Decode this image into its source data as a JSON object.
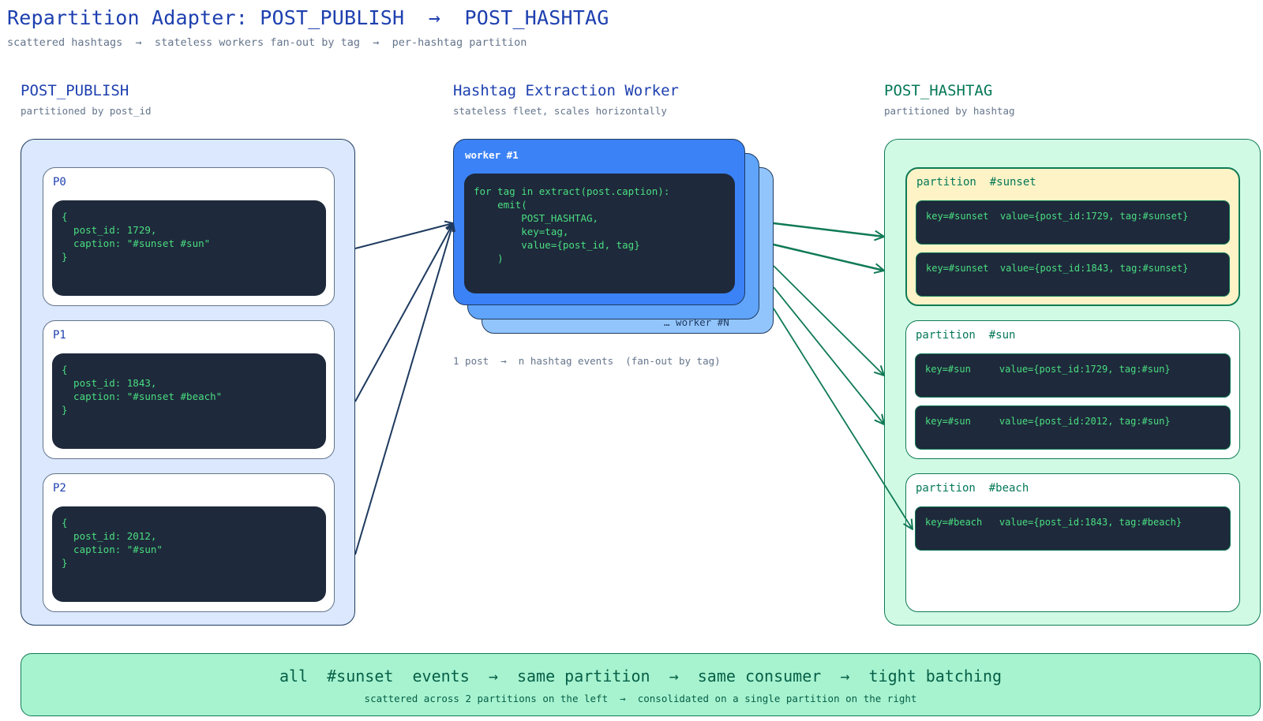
{
  "title": "Repartition Adapter: POST_PUBLISH  →  POST_HASHTAG",
  "subtitle": "scattered hashtags  →  stateless workers fan-out by tag  →  per-hashtag partition",
  "left": {
    "title": "POST_PUBLISH",
    "subtitle": "partitioned by post_id",
    "partitions": [
      {
        "label": "P0",
        "code": "{\n  post_id: 1729,\n  caption: \"#sunset #sun\"\n}"
      },
      {
        "label": "P1",
        "code": "{\n  post_id: 1843,\n  caption: \"#sunset #beach\"\n}"
      },
      {
        "label": "P2",
        "code": "{\n  post_id: 2012,\n  caption: \"#sun\"\n}"
      }
    ]
  },
  "middle": {
    "title": "Hashtag Extraction Worker",
    "subtitle": "stateless fleet, scales horizontally",
    "worker_label": "worker #1",
    "worker_n_label": "… worker #N",
    "code": "for tag in extract(post.caption):\n    emit(\n        POST_HASHTAG,\n        key=tag,\n        value={post_id, tag}\n    )",
    "note": "1 post  →  n hashtag events  (fan-out by tag)"
  },
  "right": {
    "title": "POST_HASHTAG",
    "subtitle": "partitioned by hashtag",
    "partitions": [
      {
        "label": "partition  #sunset",
        "records": [
          "key=#sunset  value={post_id:1729, tag:#sunset}",
          "key=#sunset  value={post_id:1843, tag:#sunset}"
        ]
      },
      {
        "label": "partition  #sun",
        "records": [
          "key=#sun     value={post_id:1729, tag:#sun}",
          "key=#sun     value={post_id:2012, tag:#sun}"
        ]
      },
      {
        "label": "partition  #beach",
        "records": [
          "key=#beach   value={post_id:1843, tag:#beach}"
        ]
      }
    ]
  },
  "banner": {
    "main": "all  #sunset  events  →  same partition  →  same consumer  →  tight batching",
    "sub": "scattered across 2 partitions on the left  →  consolidated on a single partition on the right"
  },
  "colors": {
    "blue_accent": "#1e40af",
    "green_accent": "#047857",
    "worker_front": "#3b82f6",
    "highlight_partition": "#fef3c7",
    "code_bg": "#1e293b",
    "code_text": "#4ade80"
  }
}
